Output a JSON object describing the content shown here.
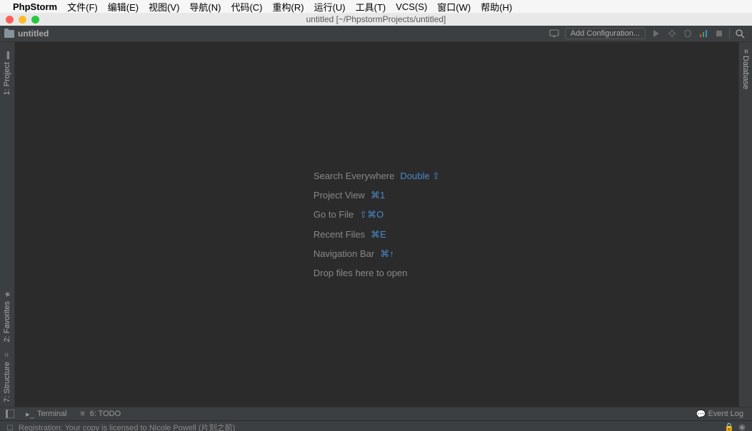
{
  "menubar": {
    "app": "PhpStorm",
    "items": [
      "文件(F)",
      "编辑(E)",
      "视图(V)",
      "导航(N)",
      "代码(C)",
      "重构(R)",
      "运行(U)",
      "工具(T)",
      "VCS(S)",
      "窗口(W)",
      "帮助(H)"
    ]
  },
  "window_title": "untitled [~/PhpstormProjects/untitled]",
  "navbar": {
    "project": "untitled",
    "add_conf": "Add Configuration..."
  },
  "left_tabs": {
    "project": "1: Project",
    "favorites": "2: Favorites",
    "structure": "7: Structure"
  },
  "right_tabs": {
    "database": "Database"
  },
  "hints": [
    {
      "label": "Search Everywhere",
      "shortcut": "Double ⇧"
    },
    {
      "label": "Project View",
      "shortcut": "⌘1"
    },
    {
      "label": "Go to File",
      "shortcut": "⇧⌘O"
    },
    {
      "label": "Recent Files",
      "shortcut": "⌘E"
    },
    {
      "label": "Navigation Bar",
      "shortcut": "⌘↑"
    },
    {
      "label": "Drop files here to open",
      "shortcut": ""
    }
  ],
  "bottom": {
    "terminal": "Terminal",
    "todo": "6: TODO",
    "eventlog": "Event Log"
  },
  "status": {
    "msg": "Registration: Your copy is licensed to Nicole Powell (片刻之前)"
  }
}
